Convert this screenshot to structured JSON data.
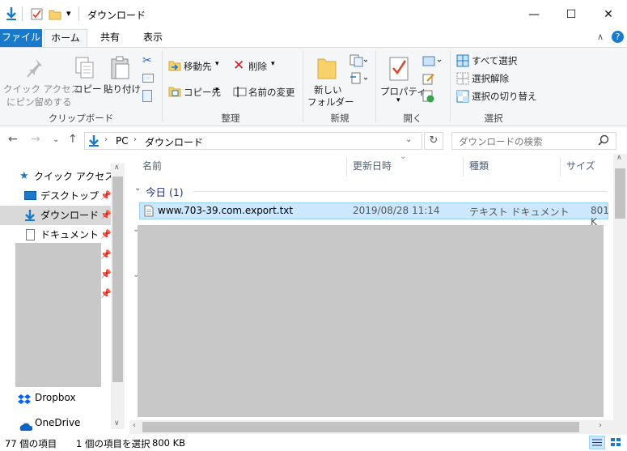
{
  "window": {
    "title": "ダウンロード",
    "minimize_glyph": "—",
    "maximize_glyph": "☐",
    "close_glyph": "✕"
  },
  "ribbon_tabs": [
    "ファイル",
    "ホーム",
    "共有",
    "表示"
  ],
  "ribbon": {
    "clipboard": {
      "pin_label_1": "クイック アクセス",
      "pin_label_2": "にピン留めする",
      "copy": "コピー",
      "paste": "貼り付け",
      "group": "クリップボード"
    },
    "organize": {
      "move_to": "移動先",
      "copy_to": "コピー先",
      "delete": "削除",
      "rename": "名前の変更",
      "group": "整理"
    },
    "new": {
      "new_folder_1": "新しい",
      "new_folder_2": "フォルダー",
      "group": "新規"
    },
    "open": {
      "properties": "プロパティ",
      "group": "開く"
    },
    "select": {
      "select_all": "すべて選択",
      "select_none": "選択解除",
      "invert": "選択の切り替え",
      "group": "選択"
    }
  },
  "address": {
    "crumbs": [
      "PC",
      "ダウンロード"
    ],
    "search_placeholder": "ダウンロードの検索"
  },
  "nav": {
    "quick_access": "クイック アクセス",
    "items": [
      {
        "label": "デスクトップ"
      },
      {
        "label": "ダウンロード"
      },
      {
        "label": "ドキュメント"
      }
    ],
    "dropbox": "Dropbox",
    "onedrive": "OneDrive"
  },
  "columns": {
    "name": "名前",
    "modified": "更新日時",
    "type": "種類",
    "size": "サイズ"
  },
  "groups": {
    "today": "今日 (1)"
  },
  "files": [
    {
      "name": "www.703-39.com.export.txt",
      "modified": "2019/08/28 11:14",
      "type": "テキスト ドキュメント",
      "size": "801 K"
    }
  ],
  "status": {
    "count": "77 個の項目",
    "selected": "1 個の項目を選択",
    "selected_size": "800 KB"
  },
  "colors": {
    "accent": "#1979ca",
    "selection": "#cce8ff",
    "selection_border": "#99d1ff",
    "redacted": "#c8c8c8"
  }
}
